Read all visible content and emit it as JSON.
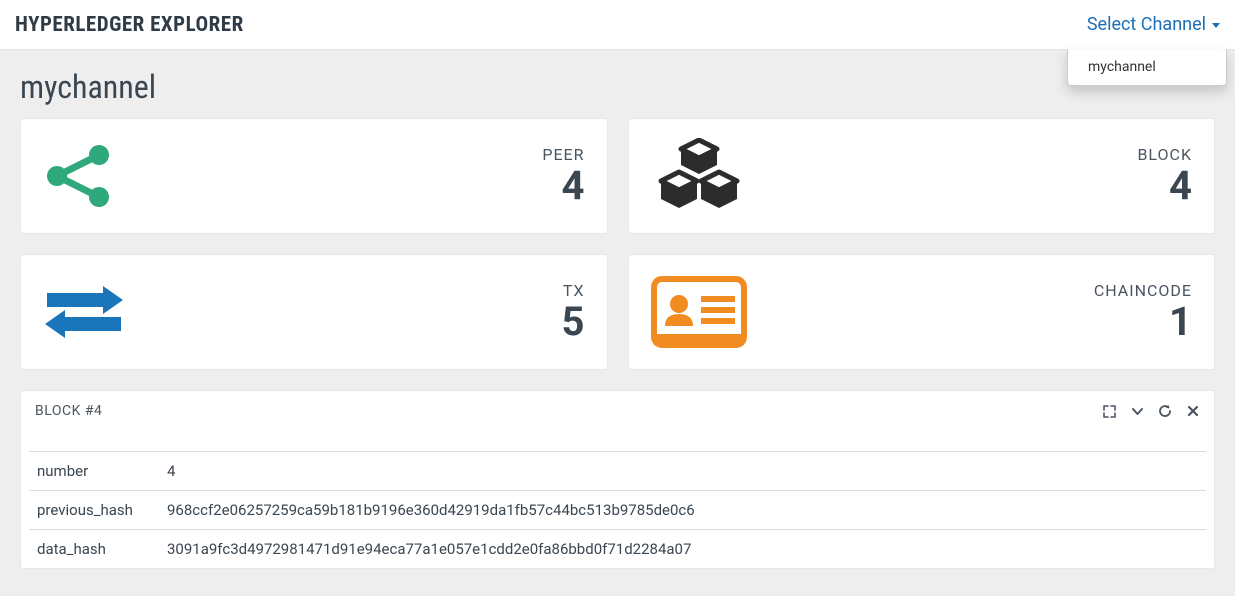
{
  "header": {
    "title": "HYPERLEDGER EXPLORER",
    "select_label": "Select Channel",
    "dropdown_items": [
      "mychannel"
    ]
  },
  "page": {
    "channel_name": "mychannel"
  },
  "cards": {
    "peer": {
      "label": "PEER",
      "value": "4"
    },
    "block": {
      "label": "BLOCK",
      "value": "4"
    },
    "tx": {
      "label": "TX",
      "value": "5"
    },
    "chaincode": {
      "label": "CHAINCODE",
      "value": "1"
    }
  },
  "block_panel": {
    "title": "BLOCK #4",
    "rows": [
      {
        "key": "number",
        "value": "4"
      },
      {
        "key": "previous_hash",
        "value": "968ccf2e06257259ca59b181b9196e360d42919da1fb57c44bc513b9785de0c6"
      },
      {
        "key": "data_hash",
        "value": "3091a9fc3d4972981471d91e94eca77a1e057e1cdd2e0fa86bbd0f71d2284a07"
      }
    ]
  },
  "colors": {
    "peer_icon": "#2fa97c",
    "block_icon": "#2c2c2c",
    "tx_icon": "#1a75bb",
    "cc_icon": "#f08c22"
  }
}
